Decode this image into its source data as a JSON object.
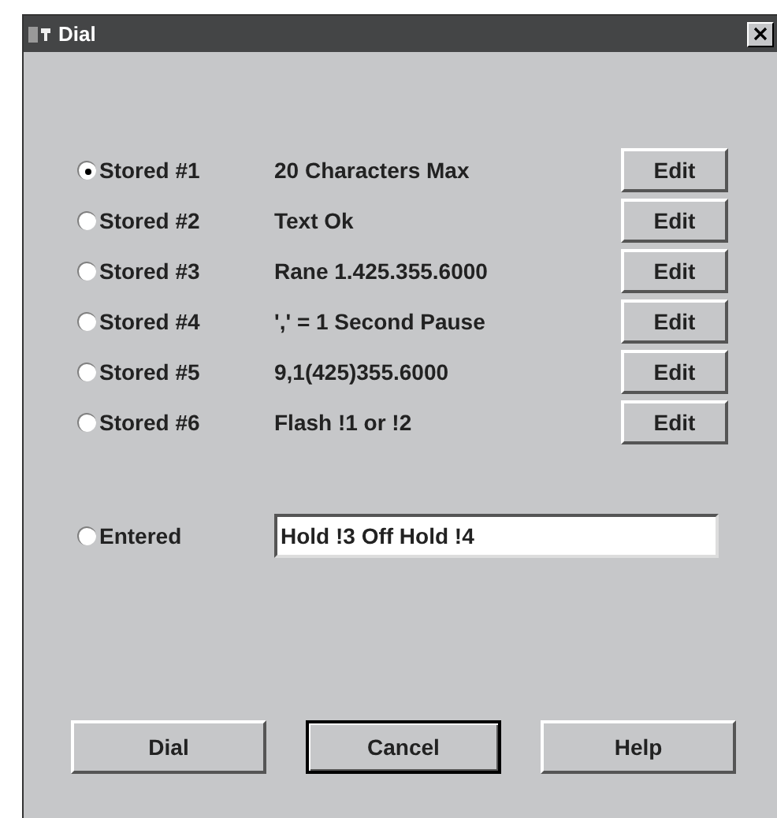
{
  "window": {
    "title": "Dial"
  },
  "stored": [
    {
      "label": "Stored #1",
      "value": "20 Characters Max",
      "button": "Edit",
      "selected": true
    },
    {
      "label": "Stored #2",
      "value": "Text Ok",
      "button": "Edit",
      "selected": false
    },
    {
      "label": "Stored #3",
      "value": "Rane 1.425.355.6000",
      "button": "Edit",
      "selected": false
    },
    {
      "label": "Stored #4",
      "value": "',' = 1 Second Pause",
      "button": "Edit",
      "selected": false
    },
    {
      "label": "Stored #5",
      "value": "9,1(425)355.6000",
      "button": "Edit",
      "selected": false
    },
    {
      "label": "Stored #6",
      "value": "Flash !1 or !2",
      "button": "Edit",
      "selected": false
    }
  ],
  "entered": {
    "label": "Entered",
    "value": "Hold !3 Off Hold !4",
    "selected": false
  },
  "buttons": [
    {
      "label": "Dial",
      "default": false
    },
    {
      "label": "Cancel",
      "default": true
    },
    {
      "label": "Help",
      "default": false
    }
  ]
}
